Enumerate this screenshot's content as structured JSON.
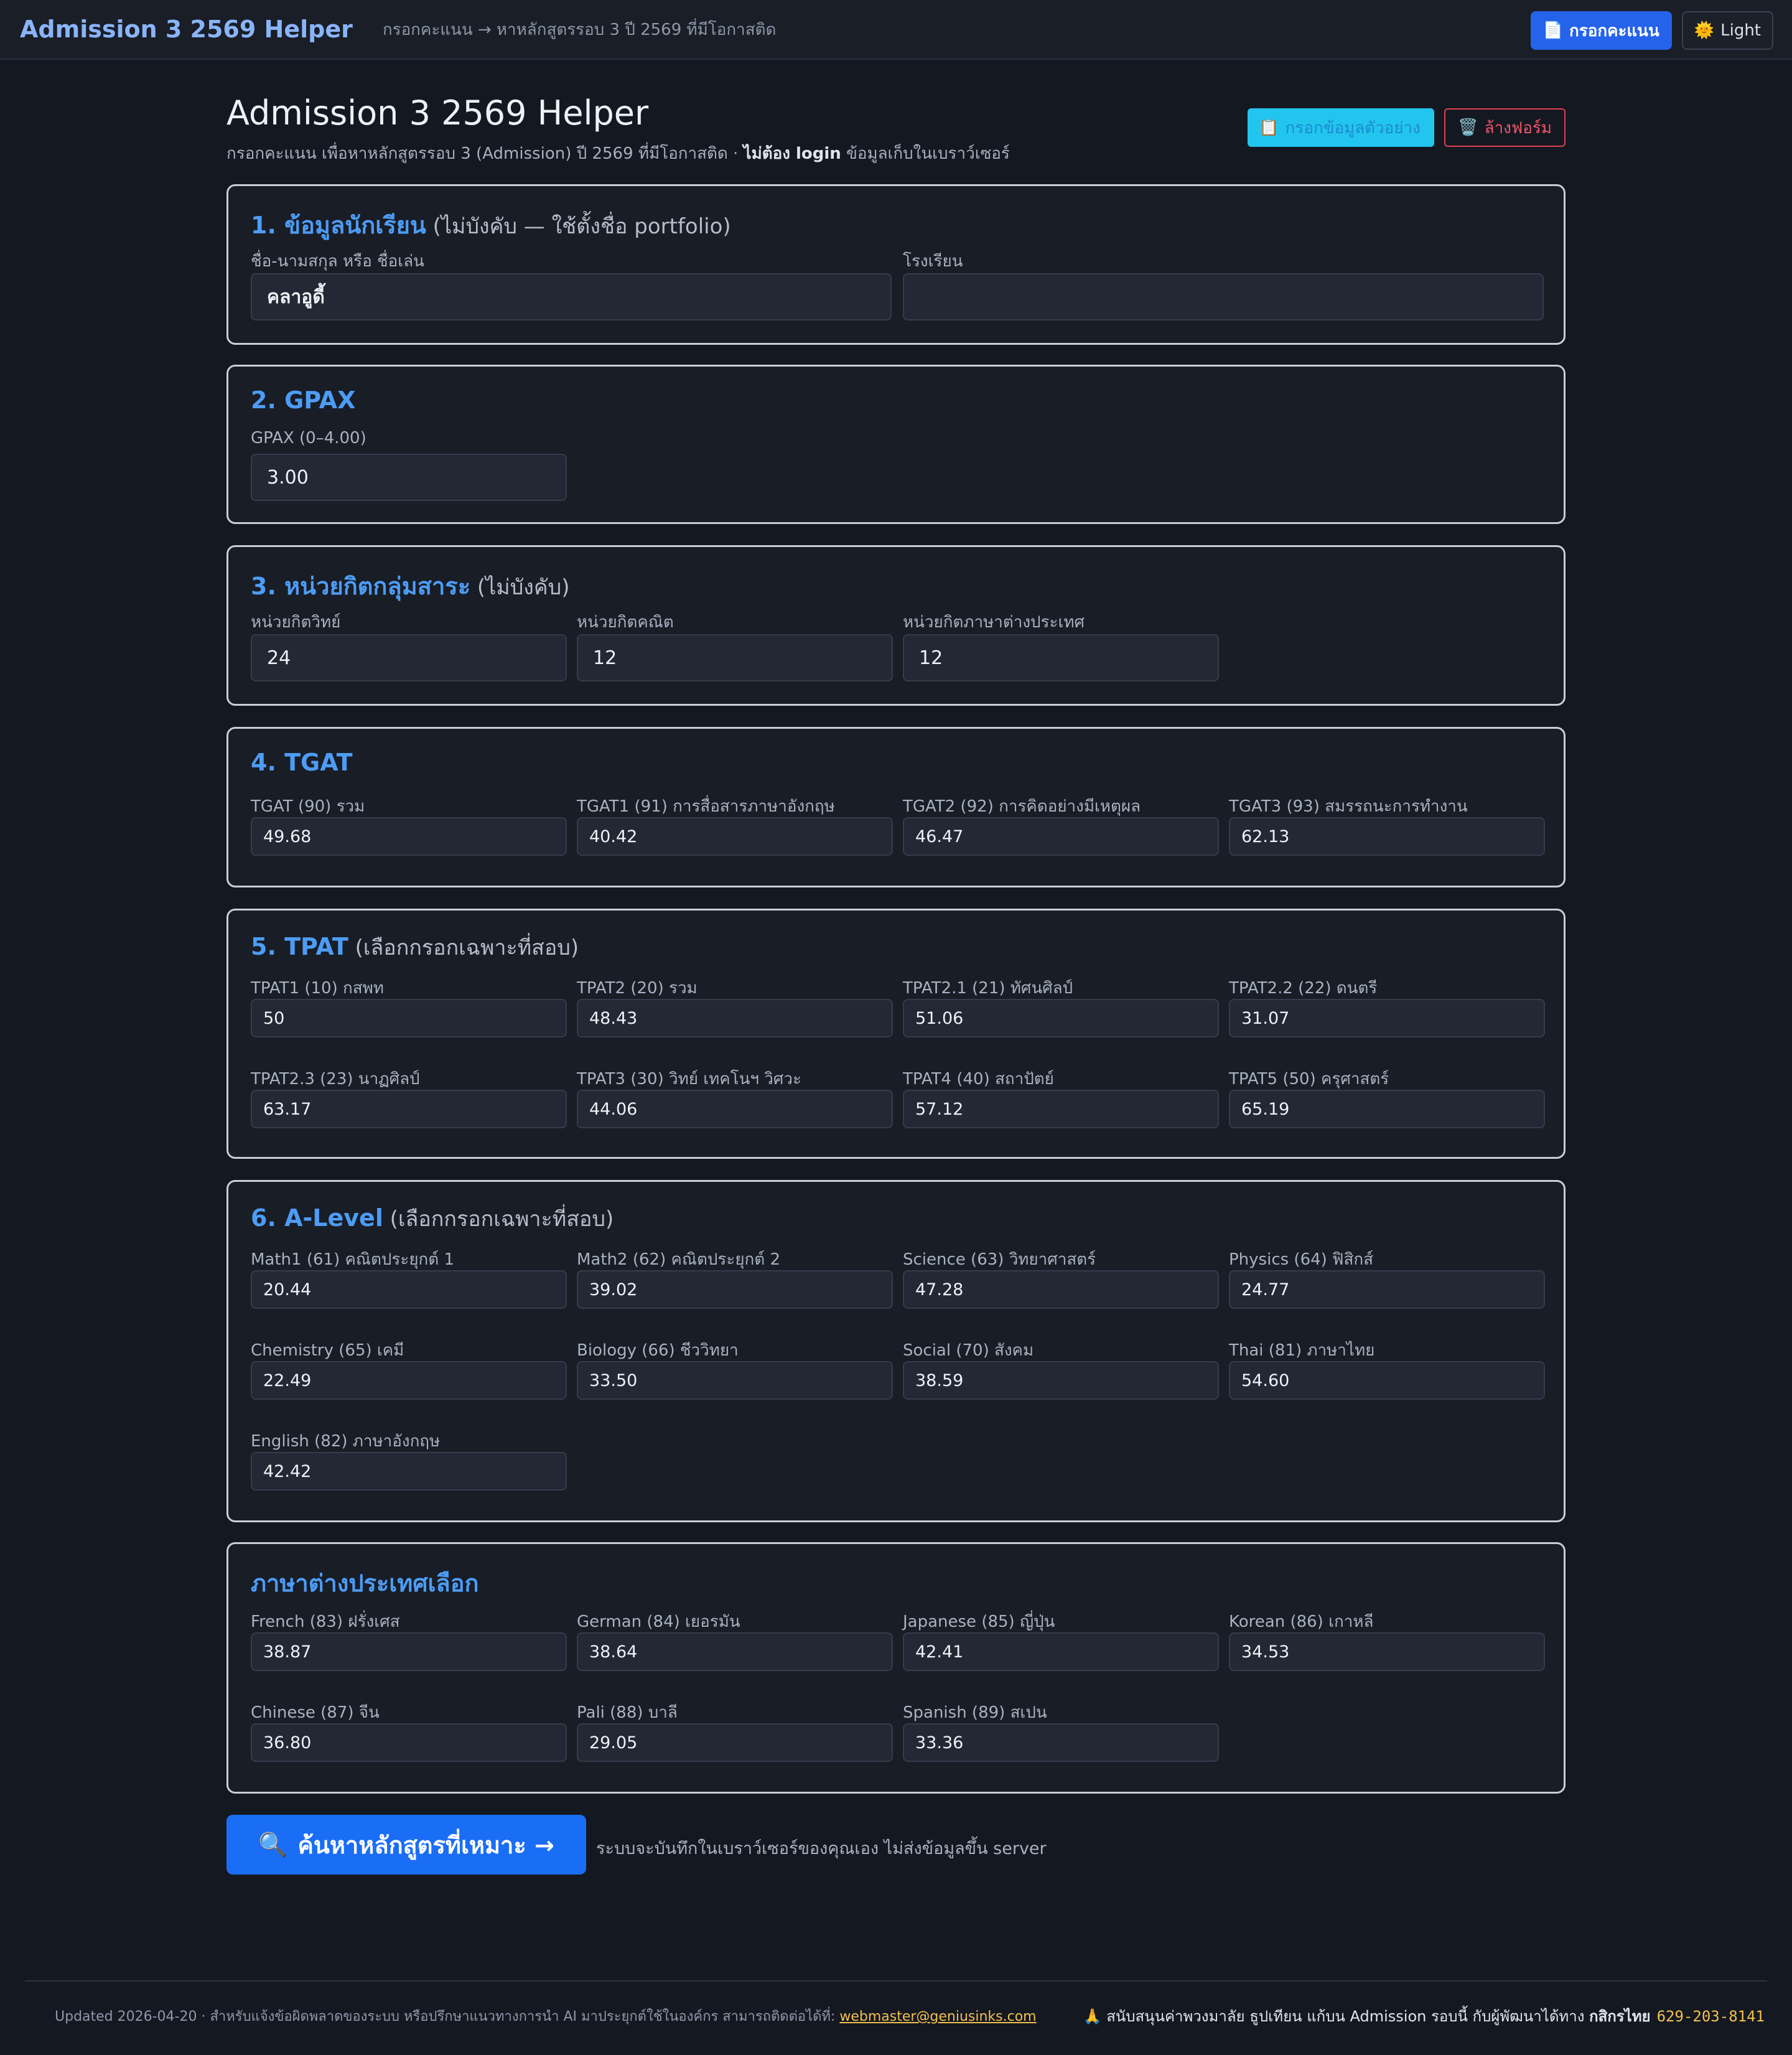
{
  "nav": {
    "brand": "Admission 3 2569 Helper",
    "subtitle": "กรอกคะแนน → หาหลักสูตรรอบ 3 ปี 2569 ที่มีโอกาสติด",
    "btn_scores": "กรอกคะแนน",
    "btn_theme": "Light",
    "icon_scores": "📄",
    "icon_theme": "🌞"
  },
  "page": {
    "title": "Admission 3 2569 Helper",
    "subtitle_a": "กรอกคะแนน เพื่อหาหลักสูตรรอบ 3 (Admission) ปี 2569 ที่มีโอกาสติด · ",
    "subtitle_b": "ไม่ต้อง login",
    "subtitle_c": " ข้อมูลเก็บในเบราว์เซอร์",
    "btn_example": "กรอกข้อมูลตัวอย่าง",
    "btn_clear": "ล้างฟอร์ม",
    "icon_example": "📋",
    "icon_clear": "🗑️"
  },
  "s1": {
    "title": "1. ข้อมูลนักเรียน",
    "opt": " (ไม่บังคับ — ใช้ตั้งชื่อ portfolio)",
    "name_label": "ชื่อ-นามสกุล หรือ ชื่อเล่น",
    "name_value": "คลาอูดี้",
    "school_label": "โรงเรียน",
    "school_value": ""
  },
  "s2": {
    "title": "2. GPAX",
    "label": "GPAX (0–4.00)",
    "value": "3.00"
  },
  "s3": {
    "title": "3. หน่วยกิตกลุ่มสาระ",
    "opt": " (ไม่บังคับ)",
    "fields": [
      {
        "label": "หน่วยกิตวิทย์",
        "value": "24"
      },
      {
        "label": "หน่วยกิตคณิต",
        "value": "12"
      },
      {
        "label": "หน่วยกิตภาษาต่างประเทศ",
        "value": "12"
      }
    ]
  },
  "s4": {
    "title": "4. TGAT",
    "fields": [
      {
        "label": "TGAT (90) รวม",
        "value": "49.68"
      },
      {
        "label": "TGAT1 (91) การสื่อสารภาษาอังกฤษ",
        "value": "40.42"
      },
      {
        "label": "TGAT2 (92) การคิดอย่างมีเหตุผล",
        "value": "46.47"
      },
      {
        "label": "TGAT3 (93) สมรรถนะการทำงาน",
        "value": "62.13"
      }
    ]
  },
  "s5": {
    "title": "5. TPAT",
    "opt": " (เลือกกรอกเฉพาะที่สอบ)",
    "fields": [
      {
        "label": "TPAT1 (10) กสพท",
        "value": "50"
      },
      {
        "label": "TPAT2 (20) รวม",
        "value": "48.43"
      },
      {
        "label": "TPAT2.1 (21) ทัศนศิลป์",
        "value": "51.06"
      },
      {
        "label": "TPAT2.2 (22) ดนตรี",
        "value": "31.07"
      },
      {
        "label": "TPAT2.3 (23) นาฏศิลป์",
        "value": "63.17"
      },
      {
        "label": "TPAT3 (30) วิทย์ เทคโนฯ วิศวะ",
        "value": "44.06"
      },
      {
        "label": "TPAT4 (40) สถาปัตย์",
        "value": "57.12"
      },
      {
        "label": "TPAT5 (50) ครุศาสตร์",
        "value": "65.19"
      }
    ]
  },
  "s6": {
    "title": "6. A-Level",
    "opt": " (เลือกกรอกเฉพาะที่สอบ)",
    "fields": [
      {
        "label": "Math1 (61) คณิตประยุกต์ 1",
        "value": "20.44"
      },
      {
        "label": "Math2 (62) คณิตประยุกต์ 2",
        "value": "39.02"
      },
      {
        "label": "Science (63) วิทยาศาสตร์",
        "value": "47.28"
      },
      {
        "label": "Physics (64) ฟิสิกส์",
        "value": "24.77"
      },
      {
        "label": "Chemistry (65) เคมี",
        "value": "22.49"
      },
      {
        "label": "Biology (66) ชีววิทยา",
        "value": "33.50"
      },
      {
        "label": "Social (70) สังคม",
        "value": "38.59"
      },
      {
        "label": "Thai (81) ภาษาไทย",
        "value": "54.60"
      },
      {
        "label": "English (82) ภาษาอังกฤษ",
        "value": "42.42"
      }
    ]
  },
  "s7": {
    "title": "ภาษาต่างประเทศเลือก",
    "fields": [
      {
        "label": "French (83) ฝรั่งเศส",
        "value": "38.87"
      },
      {
        "label": "German (84) เยอรมัน",
        "value": "38.64"
      },
      {
        "label": "Japanese (85) ญี่ปุ่น",
        "value": "42.41"
      },
      {
        "label": "Korean (86) เกาหลี",
        "value": "34.53"
      },
      {
        "label": "Chinese (87) จีน",
        "value": "36.80"
      },
      {
        "label": "Pali (88) บาลี",
        "value": "29.05"
      },
      {
        "label": "Spanish (89) สเปน",
        "value": "33.36"
      }
    ]
  },
  "search": {
    "label": "ค้นหาหลักสูตรที่เหมาะ →",
    "icon": "🔍",
    "note": "ระบบจะบันทึกในเบราว์เซอร์ของคุณเอง ไม่ส่งข้อมูลขึ้น server"
  },
  "footer": {
    "left": "Updated 2026-04-20 · สำหรับแจ้งข้อผิดพลาดของระบบ หรือปรึกษาแนวทางการนำ AI มาประยุกต์ใช้ในองค์กร สามารถติดต่อได้ที่: ",
    "email": "webmaster@geniusinks.com",
    "right_icon": "🙏",
    "right_a": "สนับสนุนค่าพวงมาลัย ธูปเทียน แก้บน Admission รอบนี้ กับผู้พัฒนาได้ทาง ",
    "bank": "กสิกรไทย",
    "account": "629-203-8141"
  }
}
